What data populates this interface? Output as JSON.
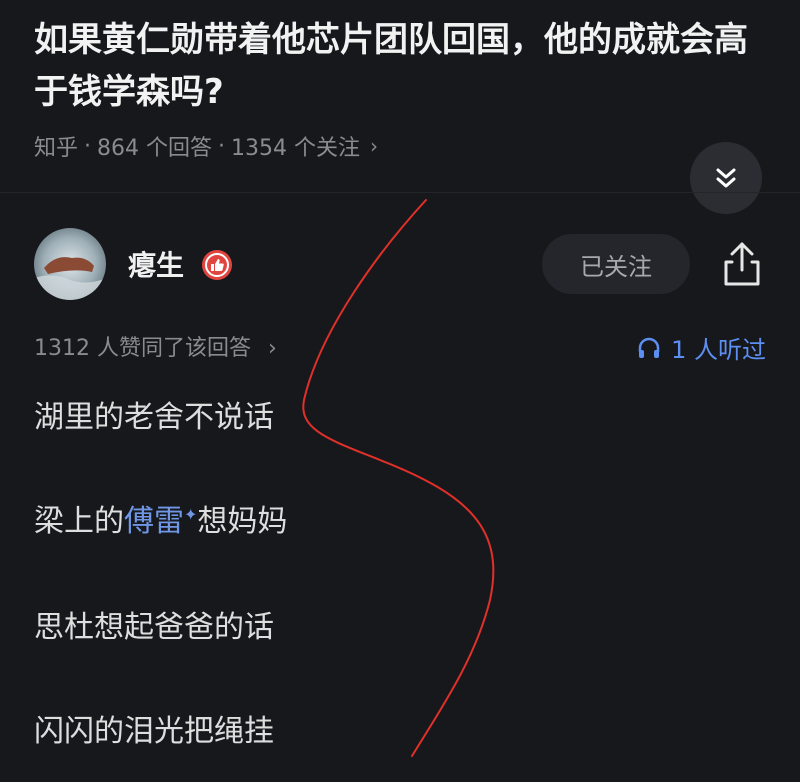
{
  "question": {
    "title": "如果黄仁勋带着他芯片团队回国，他的成就会高于钱学森吗?",
    "source": "知乎",
    "answers": "864 个回答",
    "followers": "1354 个关注"
  },
  "answer": {
    "author": "瘪生",
    "follow_label": "已关注",
    "votes_text": "1312 人赞同了该回答",
    "listen_text": "1 人听过"
  },
  "content": {
    "line1": "湖里的老舍不说话",
    "line2_prefix": "梁上的",
    "line2_highlight": "傅雷",
    "line2_suffix": "想妈妈",
    "line3": "思杜想起爸爸的话",
    "line4": "闪闪的泪光把绳挂"
  },
  "icons": {
    "collapse": "double-chevron-down-icon",
    "badge": "thumbs-up-badge-icon",
    "share": "share-icon",
    "listen": "headphones-icon"
  },
  "colors": {
    "background": "#17181c",
    "accent_blue": "#5d8ff2",
    "badge_red": "#e0463f",
    "annotation_red": "#e0302a"
  }
}
